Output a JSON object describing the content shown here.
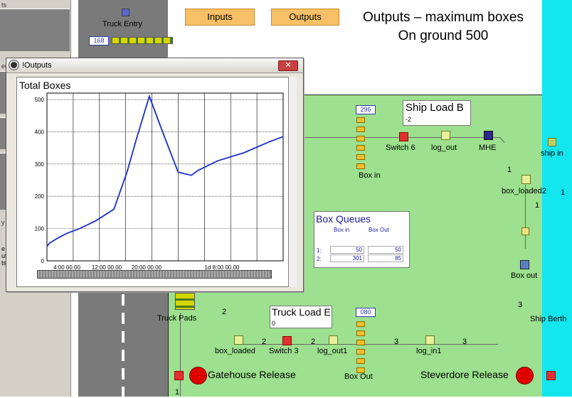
{
  "left_panel": {
    "top_label": "ts",
    "mid_label": "ec",
    "low_label": "y",
    "bottom_labels": [
      "e",
      "ut",
      "ts"
    ]
  },
  "buttons": {
    "inputs": "Inputs",
    "outputs": "Outputs"
  },
  "heading": {
    "line1": "Outputs – maximum boxes",
    "line2": "On ground 500"
  },
  "truck_entry": {
    "label": "Truck Entry",
    "count": "168"
  },
  "truck_pads": {
    "label": "Truck Pads"
  },
  "ship_load": {
    "title": "Ship Load B",
    "value": "-2"
  },
  "truck_load": {
    "title": "Truck Load E",
    "value": "0"
  },
  "box_in": {
    "label": "Box in",
    "count": "296"
  },
  "box_out": {
    "label": "Box Out",
    "count": "080"
  },
  "nodes": {
    "switch6": "Switch 6",
    "log_out": "log_out",
    "mhe": "MHE",
    "box_loaded2": "box_loaded2",
    "box_out_node": "Box out",
    "ship_in": "ship in",
    "ship_berth": "Ship Berth",
    "box_loaded": "box_loaded",
    "switch3": "Switch 3",
    "log_out1": "log_out1",
    "log_in1": "log_in1",
    "gatehouse": "Gatehouse Release",
    "steverdore": "Steverdore Release"
  },
  "edge_labels": {
    "e1": "1",
    "e2": "1",
    "e3": "3",
    "e4": "2",
    "e5": "2",
    "e6": "2",
    "e7": "3",
    "e8": "3",
    "e9": "1",
    "e10": "1"
  },
  "box_queues": {
    "title": "Box Queues",
    "col1": "Box in",
    "col2": "Box Out",
    "rows": [
      {
        "label": "1:",
        "box_in": "50",
        "box_out": "50"
      },
      {
        "label": "2:",
        "box_in": "301",
        "box_out": "85"
      }
    ]
  },
  "window": {
    "title": "!Outputs",
    "close_icon": "close-icon"
  },
  "chart_data": {
    "type": "line",
    "title": "Total Boxes",
    "ylim": [
      0,
      520
    ],
    "yticks": [
      0,
      100,
      200,
      300,
      400,
      500
    ],
    "xticks_labels": [
      "4:00 00.00",
      "12:00 00.00",
      "20:00 00.00",
      "1d  8:00 00.00"
    ],
    "xlim": [
      0,
      36
    ],
    "grid": true,
    "series": [
      {
        "x": [
          0,
          0.4,
          1.6,
          3.0,
          5.0,
          7.5,
          10.2,
          12.2,
          13.6,
          15.6,
          17.8,
          20.0,
          22.0,
          23.0,
          26.0,
          30.0,
          34.0,
          36.0
        ],
        "values": [
          45,
          55,
          70,
          85,
          100,
          125,
          160,
          275,
          375,
          510,
          390,
          275,
          265,
          280,
          310,
          335,
          370,
          385
        ],
        "color": "#1a2fc8"
      }
    ]
  }
}
